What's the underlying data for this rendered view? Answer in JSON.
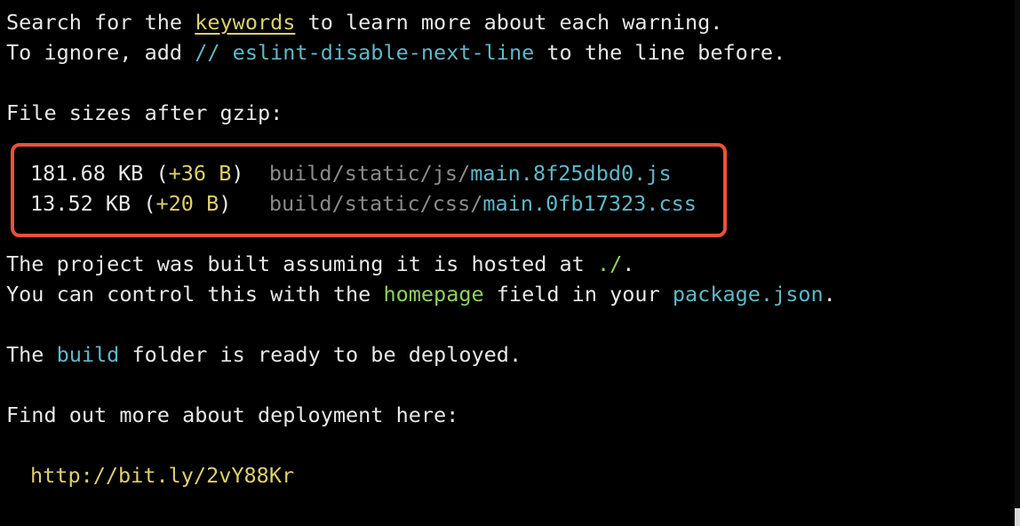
{
  "colors": {
    "background": "#000000",
    "text": "#e8e8e8",
    "yellow": "#dccf6e",
    "cyan": "#5fb8c8",
    "green": "#8fd15f",
    "gray": "#8a8a8a",
    "highlight_border": "#e8523b"
  },
  "terminal": {
    "line1": {
      "prefix": "Search for the ",
      "keywords": "keywords",
      "suffix": " to learn more about each warning."
    },
    "line2": {
      "prefix": "To ignore, add ",
      "comment": "// eslint-disable-next-line",
      "suffix": " to the line before."
    },
    "file_sizes_header": "File sizes after gzip:",
    "files": [
      {
        "size": "181.68 KB",
        "open": " (",
        "diff": "+36 B",
        "close": ")",
        "pad": "  ",
        "dir": "build/static/js/",
        "name": "main.8f25dbd0.js"
      },
      {
        "size": "13.52 KB",
        "open": " (",
        "diff": "+20 B",
        "close": ")",
        "pad": "   ",
        "dir": "build/static/css/",
        "name": "main.0fb17323.css"
      }
    ],
    "hosted": {
      "prefix": "The project was built assuming it is hosted at ",
      "path": "./",
      "suffix": "."
    },
    "control": {
      "prefix": "You can control this with the ",
      "field": "homepage",
      "middle": " field in your ",
      "file": "package.json",
      "suffix": "."
    },
    "ready": {
      "prefix": "The ",
      "folder": "build",
      "suffix": " folder is ready to be deployed."
    },
    "find_out": "Find out more about deployment here:",
    "url": "http://bit.ly/2vY88Kr"
  }
}
